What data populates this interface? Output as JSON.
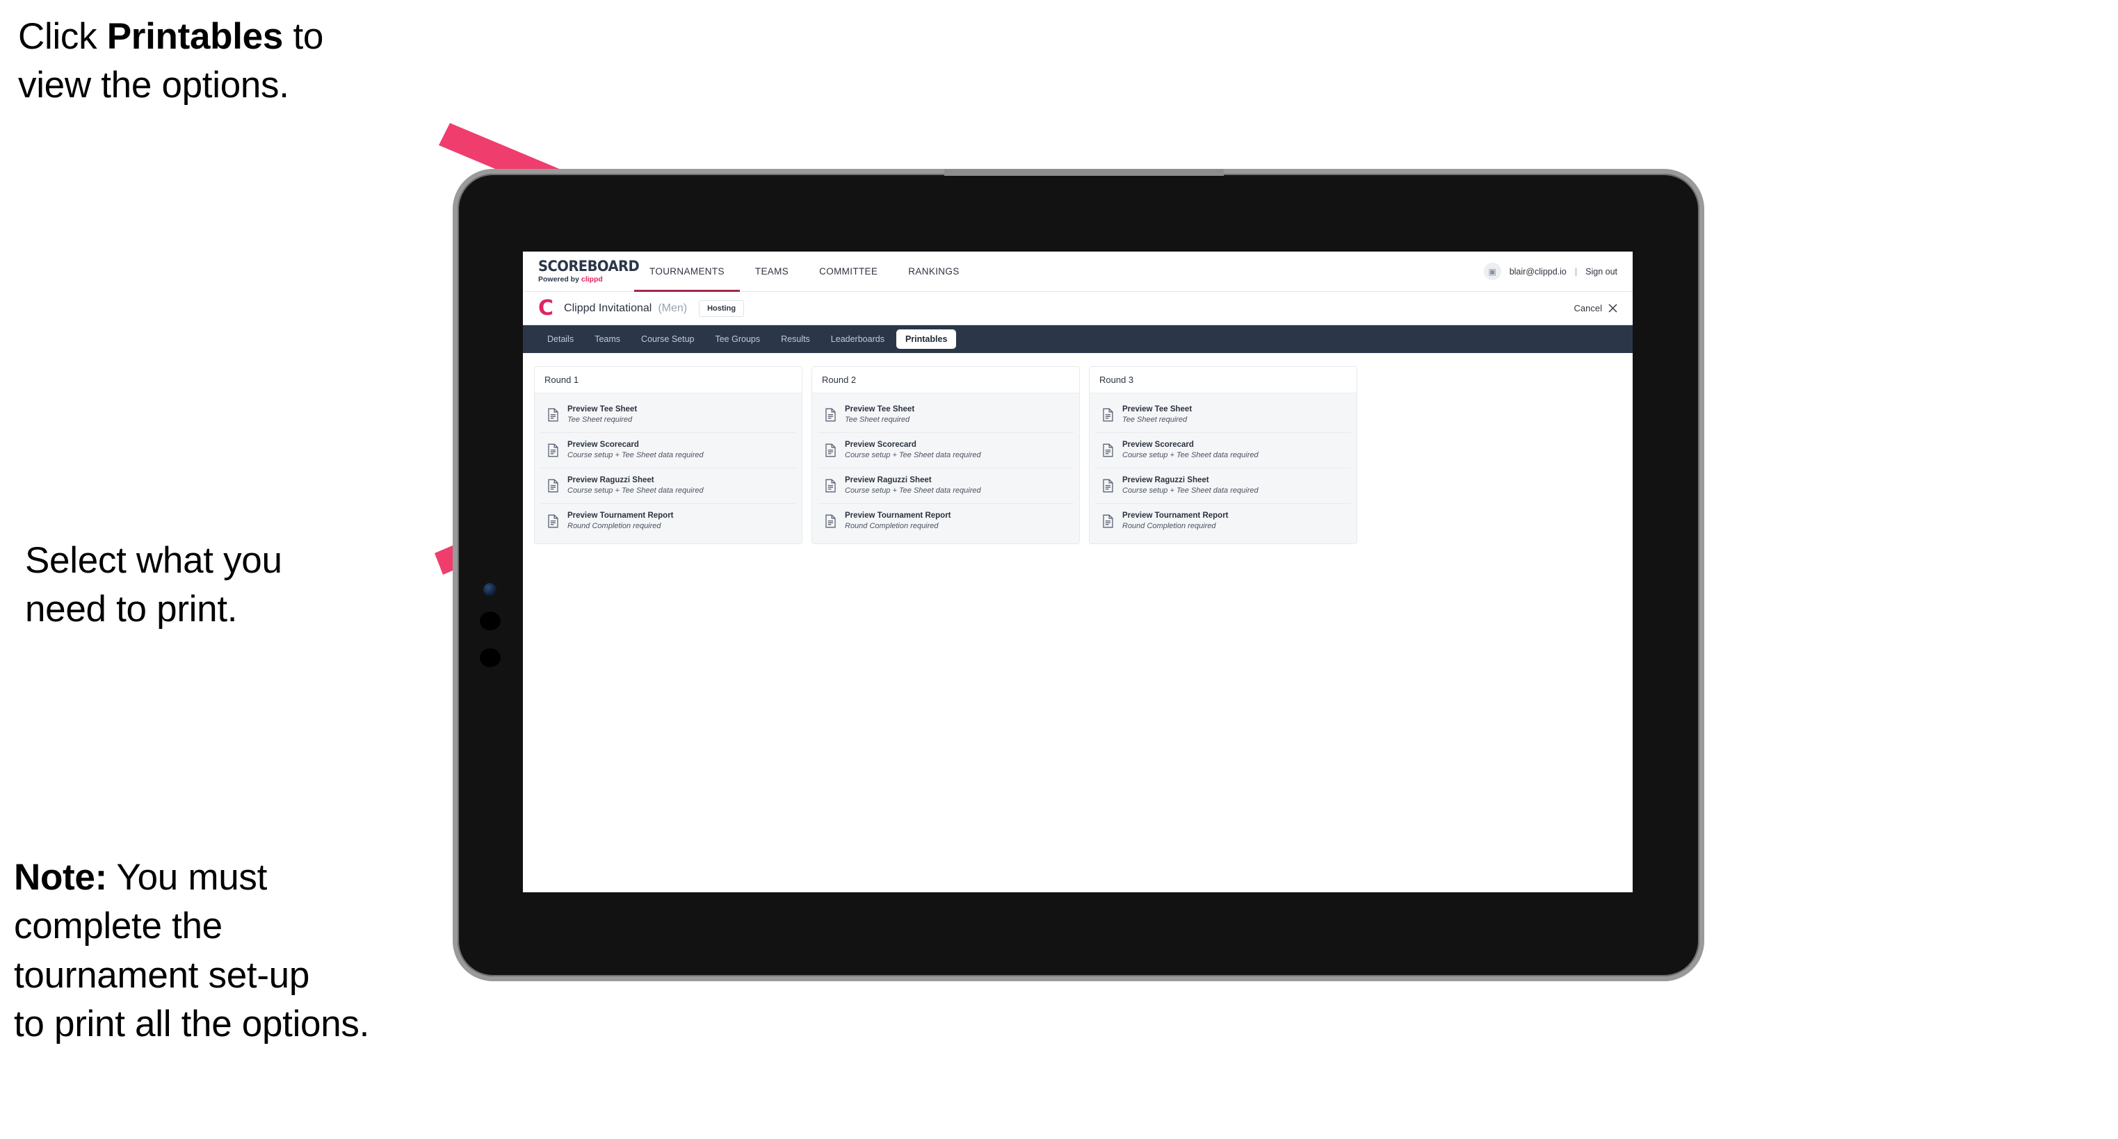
{
  "annotations": [
    {
      "id": "annot-1",
      "prefix": "Click ",
      "bold": "Printables",
      "suffix": " to\nview the options."
    },
    {
      "id": "annot-2",
      "prefix": "",
      "bold": "",
      "suffix": "Select what you\n need to print."
    },
    {
      "id": "annot-3",
      "prefix": "",
      "bold": "Note:",
      "suffix": " You must\ncomplete the\ntournament set-up\nto print all the options."
    }
  ],
  "app": {
    "logo": {
      "main": "SCOREBOARD",
      "powered_prefix": "Powered by ",
      "brand": "clippd"
    },
    "top_nav": [
      {
        "label": "TOURNAMENTS",
        "active": true
      },
      {
        "label": "TEAMS",
        "active": false
      },
      {
        "label": "COMMITTEE",
        "active": false
      },
      {
        "label": "RANKINGS",
        "active": false
      }
    ],
    "user": {
      "avatar_icon": "user-image-icon",
      "email": "blair@clippd.io",
      "separator": "|",
      "sign_out": "Sign out"
    },
    "tournament": {
      "logo_mark": "C",
      "name": "Clippd Invitational",
      "gender": "(Men)",
      "status_badge": "Hosting",
      "cancel_label": "Cancel",
      "cancel_icon": "close-icon"
    },
    "tabs": [
      {
        "label": "Details",
        "active": false
      },
      {
        "label": "Teams",
        "active": false
      },
      {
        "label": "Course Setup",
        "active": false
      },
      {
        "label": "Tee Groups",
        "active": false
      },
      {
        "label": "Results",
        "active": false
      },
      {
        "label": "Leaderboards",
        "active": false
      },
      {
        "label": "Printables",
        "active": true
      }
    ],
    "rounds": [
      {
        "title": "Round 1",
        "items": [
          {
            "icon": "document-icon",
            "title": "Preview Tee Sheet",
            "subtitle": "Tee Sheet required"
          },
          {
            "icon": "document-icon",
            "title": "Preview Scorecard",
            "subtitle": "Course setup + Tee Sheet data required"
          },
          {
            "icon": "document-icon",
            "title": "Preview Raguzzi Sheet",
            "subtitle": "Course setup + Tee Sheet data required"
          },
          {
            "icon": "document-icon",
            "title": "Preview Tournament Report",
            "subtitle": "Round Completion required"
          }
        ]
      },
      {
        "title": "Round 2",
        "items": [
          {
            "icon": "document-icon",
            "title": "Preview Tee Sheet",
            "subtitle": "Tee Sheet required"
          },
          {
            "icon": "document-icon",
            "title": "Preview Scorecard",
            "subtitle": "Course setup + Tee Sheet data required"
          },
          {
            "icon": "document-icon",
            "title": "Preview Raguzzi Sheet",
            "subtitle": "Course setup + Tee Sheet data required"
          },
          {
            "icon": "document-icon",
            "title": "Preview Tournament Report",
            "subtitle": "Round Completion required"
          }
        ]
      },
      {
        "title": "Round 3",
        "items": [
          {
            "icon": "document-icon",
            "title": "Preview Tee Sheet",
            "subtitle": "Tee Sheet required"
          },
          {
            "icon": "document-icon",
            "title": "Preview Scorecard",
            "subtitle": "Course setup + Tee Sheet data required"
          },
          {
            "icon": "document-icon",
            "title": "Preview Raguzzi Sheet",
            "subtitle": "Course setup + Tee Sheet data required"
          },
          {
            "icon": "document-icon",
            "title": "Preview Tournament Report",
            "subtitle": "Round Completion required"
          }
        ]
      }
    ]
  },
  "colors": {
    "accent_pink": "#ef3d6d",
    "brand_red": "#e0245e",
    "nav_underline": "#9e2b4e",
    "tabbar_navy": "#2b3749",
    "card_bg": "#f5f6f8",
    "bezel_gray": "#9a9a9a"
  }
}
